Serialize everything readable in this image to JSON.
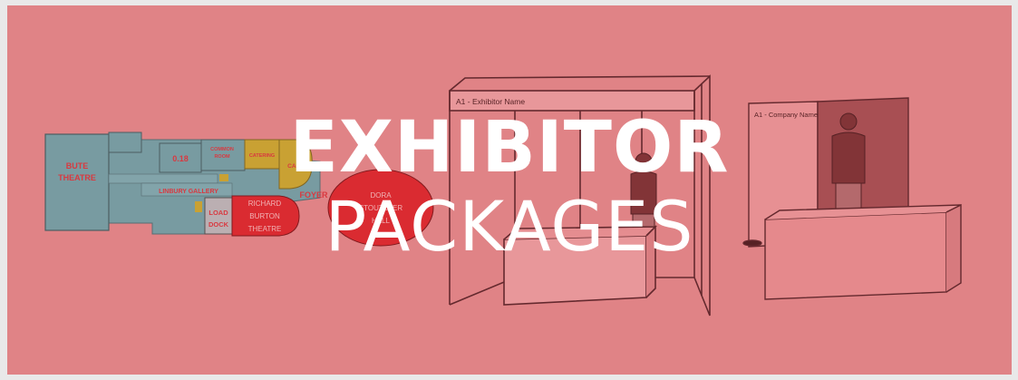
{
  "banner": {
    "title_line1": "EXHIBITOR",
    "title_line2": "PACKAGES",
    "background_color": "#e08486"
  },
  "floorplan": {
    "labels": {
      "bute_1": "BUTE",
      "bute_2": "THEATRE",
      "room_018": "0.18",
      "common_1": "COMMON",
      "common_2": "ROOM",
      "catering": "CATERING",
      "cafe": "CAFE",
      "linbury": "LINBURY GALLERY",
      "richard_1": "RICHARD",
      "richard_2": "BURTON",
      "richard_3": "THEATRE",
      "foyer": "FOYER",
      "load_1": "LOAD",
      "load_2": "DOCK",
      "dora_1": "DORA",
      "dora_2": "STOUTZKER",
      "dora_3": "HALL"
    },
    "colors": {
      "room": "#6f9ea3",
      "catering": "#c7a42c",
      "theatre": "#d9242a"
    }
  },
  "shell_booth": {
    "fascia_label": "A1 - Exhibitor Name"
  },
  "panel_booth": {
    "header_label": "A1 - Company Name"
  }
}
